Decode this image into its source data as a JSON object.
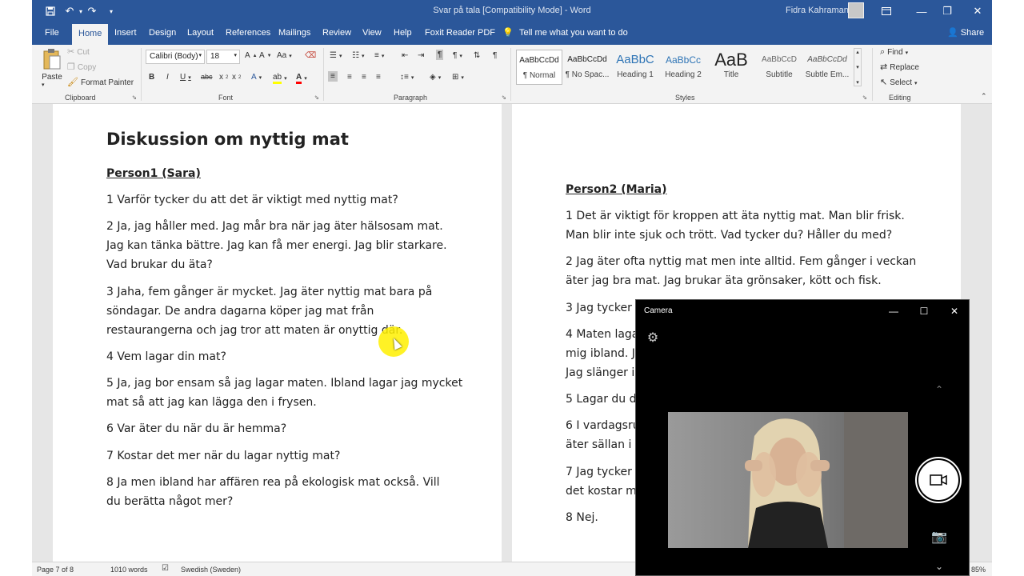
{
  "title_bar": {
    "doc_title": "Svar på tala [Compatibility Mode] - Word",
    "user_name": "Fidra Kahraman",
    "icons": [
      "save-icon",
      "undo-icon",
      "redo-icon",
      "customize-icon"
    ]
  },
  "menu": {
    "tabs": [
      "File",
      "Home",
      "Insert",
      "Design",
      "Layout",
      "References",
      "Mailings",
      "Review",
      "View",
      "Help",
      "Foxit Reader PDF"
    ],
    "tell_me": "Tell me what you want to do",
    "share": "Share"
  },
  "ribbon": {
    "clipboard": {
      "paste": "Paste",
      "cut": "Cut",
      "copy": "Copy",
      "format_painter": "Format Painter",
      "label": "Clipboard"
    },
    "font": {
      "name": "Calibri (Body)",
      "size": "18",
      "label": "Font"
    },
    "paragraph": {
      "label": "Paragraph"
    },
    "styles": {
      "label": "Styles",
      "items": [
        {
          "preview": "AaBbCcDd",
          "name": "¶ Normal"
        },
        {
          "preview": "AaBbCcDd",
          "name": "¶ No Spac..."
        },
        {
          "preview": "AaBbC",
          "name": "Heading 1"
        },
        {
          "preview": "AaBbCc",
          "name": "Heading 2"
        },
        {
          "preview": "AaB",
          "name": "Title"
        },
        {
          "preview": "AaBbCcD",
          "name": "Subtitle"
        },
        {
          "preview": "AaBbCcDd",
          "name": "Subtle Em..."
        }
      ]
    },
    "editing": {
      "find": "Find",
      "replace": "Replace",
      "select": "Select",
      "label": "Editing"
    }
  },
  "left_page": {
    "heading": "Diskussion om nyttig mat",
    "person": "Person1 (Sara)",
    "paragraphs": [
      [
        "1 Varför tycker du att det är viktigt med nyttig mat?"
      ],
      [
        "2 Ja, jag håller med. Jag mår bra när jag äter hälsosam mat.",
        "Jag kan tänka bättre. Jag kan få mer energi. Jag blir starkare.",
        "Vad brukar du äta?"
      ],
      [
        "3 Jaha, fem gånger är mycket. Jag äter nyttig mat bara på",
        "söndagar. De andra dagarna köper jag mat från",
        "restaurangerna och jag tror att maten är onyttig där."
      ],
      [
        "4 Vem lagar din mat?"
      ],
      [
        "5 Ja, jag bor ensam så jag lagar maten. Ibland lagar jag mycket",
        "mat så att jag kan lägga den i frysen."
      ],
      [
        "6 Var äter du när du är hemma?"
      ],
      [
        "7 Kostar det mer när du lagar nyttig mat?"
      ],
      [
        "8 Ja men ibland har affären rea på ekologisk mat också. Vill",
        "du berätta något mer?"
      ]
    ]
  },
  "right_page": {
    "person": "Person2 (Maria)",
    "paragraphs": [
      [
        "1 Det är viktigt för kroppen att äta nyttig mat. Man blir frisk.",
        "Man blir inte sjuk och trött. Vad tycker du? Håller du med?"
      ],
      [
        "2 Jag äter ofta nyttig mat men inte alltid. Fem gånger i veckan",
        "äter jag bra mat. Jag brukar äta grönsaker, kött och fisk."
      ],
      [
        "3 Jag tycker i"
      ],
      [
        "4 Maten laga",
        "mig ibland. Ja",
        "Jag slänger in"
      ],
      [
        "5 Lagar du di"
      ],
      [
        "6 I vardagsru",
        "äter sällan i k"
      ],
      [
        "7 Jag tycker a",
        "det kostar m"
      ],
      [
        "8 Nej."
      ]
    ]
  },
  "status_bar": {
    "page": "Page 7 of 8",
    "words": "1010 words",
    "language": "Swedish (Sweden)",
    "zoom": "85%"
  },
  "camera": {
    "title": "Camera"
  }
}
